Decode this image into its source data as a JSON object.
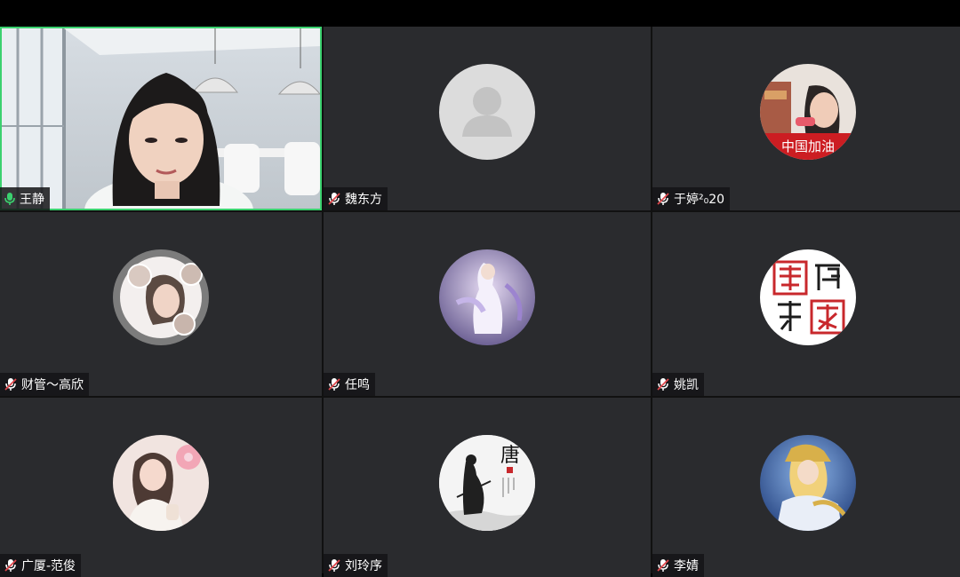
{
  "participants": [
    {
      "name": "王静",
      "mic": "on",
      "video": true,
      "speaking": true
    },
    {
      "name": "魏东方",
      "mic": "muted",
      "avatar": "default-person"
    },
    {
      "name": "于婷²₀20",
      "mic": "muted",
      "avatar": "photo",
      "avatar_text": "中国加油"
    },
    {
      "name": "财管～高欣",
      "mic": "muted",
      "avatar": "photo"
    },
    {
      "name": "任鸣",
      "mic": "muted",
      "avatar": "illustration"
    },
    {
      "name": "姚凯",
      "mic": "muted",
      "avatar": "seal"
    },
    {
      "name": "广厦-范俊",
      "mic": "muted",
      "avatar": "photo"
    },
    {
      "name": "刘玲序",
      "mic": "muted",
      "avatar": "ink-painting",
      "avatar_text": "唐"
    },
    {
      "name": "李婧",
      "mic": "muted",
      "avatar": "illustration"
    }
  ],
  "colors": {
    "tile_bg": "#2a2b2e",
    "active_border": "#3bd16f",
    "mic_on": "#3bd16f",
    "mic_muted": "#ffffff"
  }
}
